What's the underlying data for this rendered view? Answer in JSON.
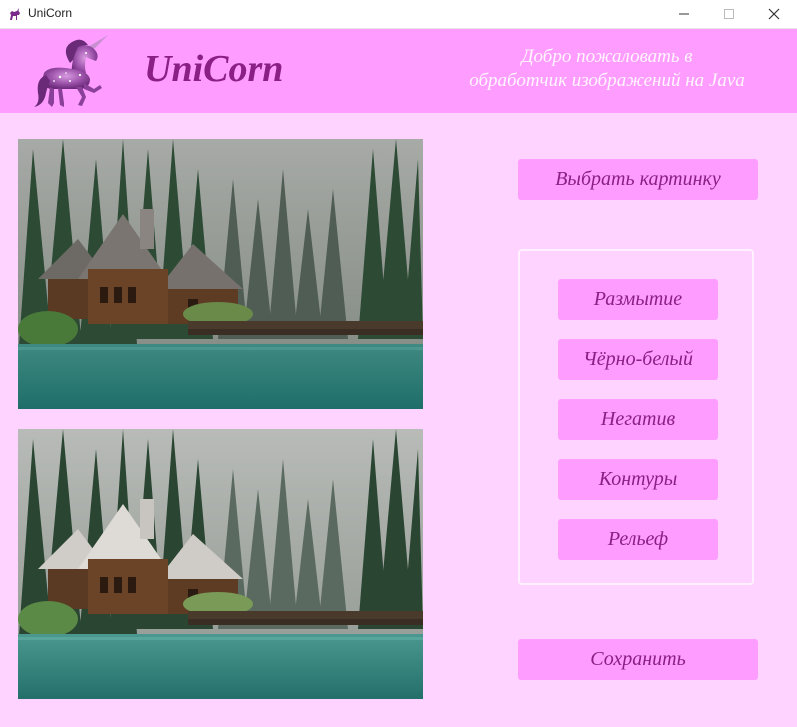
{
  "window": {
    "title": "UniCorn"
  },
  "header": {
    "brand": "UniCorn",
    "welcome_line1": "Добро пожаловать в",
    "welcome_line2": "обработчик изображений на Java"
  },
  "actions": {
    "choose_image": "Выбрать картинку",
    "save": "Сохранить"
  },
  "filters": [
    {
      "label": "Размытие"
    },
    {
      "label": "Чёрно-белый"
    },
    {
      "label": "Негатив"
    },
    {
      "label": "Контуры"
    },
    {
      "label": "Рельеф"
    }
  ],
  "colors": {
    "background": "#ffd3ff",
    "header": "#ff9cff",
    "button": "#ff9cff",
    "button_text": "#8a1f86",
    "brand_text": "#8a1f86"
  },
  "icons": {
    "app": "unicorn-icon",
    "minimize": "minimize-icon",
    "maximize": "maximize-icon",
    "close": "close-icon"
  }
}
